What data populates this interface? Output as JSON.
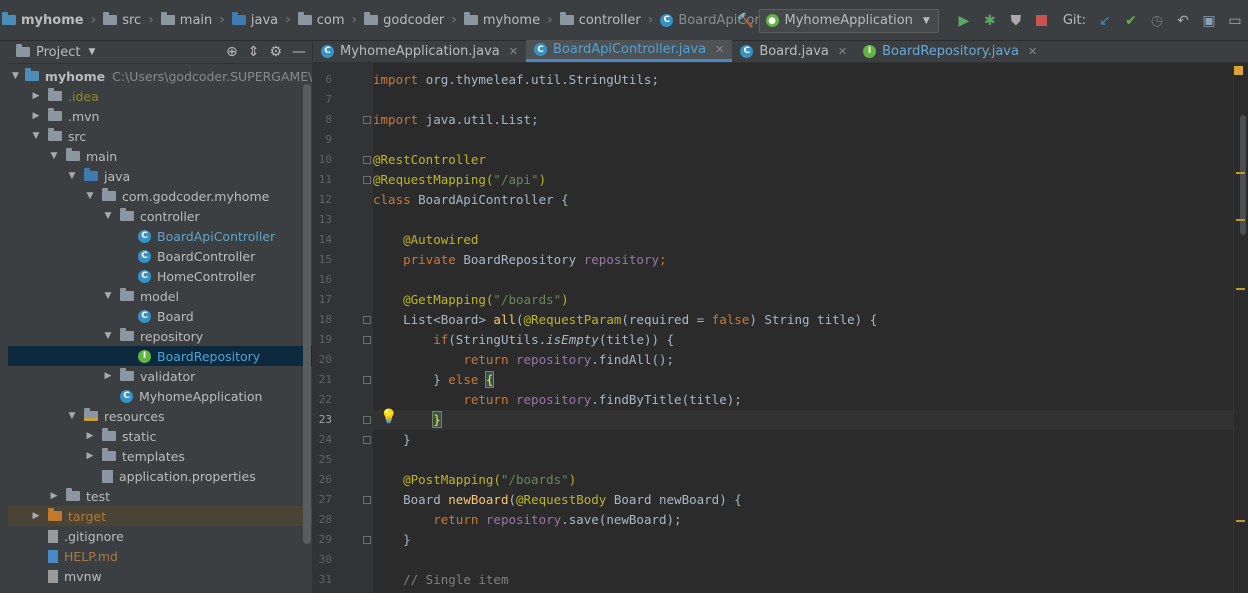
{
  "breadcrumbs": [
    "myhome",
    "src",
    "main",
    "java",
    "com",
    "godcoder",
    "myhome",
    "controller",
    "BoardApiController"
  ],
  "run_config": "MyhomeApplication",
  "git_label": "Git:",
  "project_panel": {
    "title": "Project",
    "tree": [
      {
        "label": "myhome",
        "extra": "C:\\Users\\godcoder.SUPERGAME\\Do",
        "icon": "module-folder-icon",
        "arrow": "down"
      },
      {
        "label": ".idea",
        "icon": "folder-icon",
        "arrow": "right"
      },
      {
        "label": ".mvn",
        "icon": "folder-icon",
        "arrow": "right"
      },
      {
        "label": "src",
        "icon": "folder-icon",
        "arrow": "down"
      },
      {
        "label": "main",
        "icon": "folder-icon",
        "arrow": "down"
      },
      {
        "label": "java",
        "icon": "source-folder-icon",
        "arrow": "down"
      },
      {
        "label": "com.godcoder.myhome",
        "icon": "package-icon",
        "arrow": "down"
      },
      {
        "label": "controller",
        "icon": "package-icon",
        "arrow": "down"
      },
      {
        "label": "BoardApiController",
        "icon": "class-icon",
        "arrow": ""
      },
      {
        "label": "BoardController",
        "icon": "class-icon",
        "arrow": ""
      },
      {
        "label": "HomeController",
        "icon": "class-icon",
        "arrow": ""
      },
      {
        "label": "model",
        "icon": "package-icon",
        "arrow": "down"
      },
      {
        "label": "Board",
        "icon": "class-icon",
        "arrow": ""
      },
      {
        "label": "repository",
        "icon": "package-icon",
        "arrow": "down"
      },
      {
        "label": "BoardRepository",
        "icon": "interface-icon",
        "arrow": ""
      },
      {
        "label": "validator",
        "icon": "package-icon",
        "arrow": "right"
      },
      {
        "label": "MyhomeApplication",
        "icon": "spring-class-icon",
        "arrow": ""
      },
      {
        "label": "resources",
        "icon": "resources-folder-icon",
        "arrow": "down"
      },
      {
        "label": "static",
        "icon": "folder-icon",
        "arrow": "right"
      },
      {
        "label": "templates",
        "icon": "folder-icon",
        "arrow": "right"
      },
      {
        "label": "application.properties",
        "icon": "properties-file-icon",
        "arrow": ""
      },
      {
        "label": "test",
        "icon": "folder-icon",
        "arrow": "right"
      },
      {
        "label": "target",
        "icon": "excluded-folder-icon",
        "arrow": "right"
      },
      {
        "label": ".gitignore",
        "icon": "text-file-icon",
        "arrow": ""
      },
      {
        "label": "HELP.md",
        "icon": "markdown-file-icon",
        "arrow": ""
      },
      {
        "label": "mvnw",
        "icon": "text-file-icon",
        "arrow": ""
      }
    ]
  },
  "editor_tabs": [
    {
      "label": "MyhomeApplication.java",
      "icon": "class-icon"
    },
    {
      "label": "BoardApiController.java",
      "icon": "class-icon",
      "active": true
    },
    {
      "label": "Board.java",
      "icon": "class-icon"
    },
    {
      "label": "BoardRepository.java",
      "icon": "interface-icon"
    }
  ],
  "line_numbers": [
    "6",
    "7",
    "8",
    "9",
    "10",
    "11",
    "12",
    "13",
    "14",
    "15",
    "16",
    "17",
    "18",
    "19",
    "20",
    "21",
    "22",
    "23",
    "24",
    "25",
    "26",
    "27",
    "28",
    "29",
    "30",
    "31"
  ],
  "code": {
    "l6": "import org.thymeleaf.util.StringUtils;",
    "l8": "import java.util.List;",
    "l10_ann": "@RestController",
    "l11_ann": "@RequestMapping(",
    "l11_str": "\"/api\"",
    "l12_kw": "class ",
    "l12_name": "BoardApiController {",
    "l14_ann": "@Autowired",
    "l15_kw": "private ",
    "l15_type": "BoardRepository ",
    "l15_fld": "repository",
    "l17_ann": "@GetMapping(",
    "l17_str": "\"/boards\"",
    "l18_a": "List<Board> ",
    "l18_m": "all",
    "l18_b": "(",
    "l18_ann": "@RequestParam",
    "l18_c": "(required = ",
    "l18_kw": "false",
    "l18_d": ") String title) {",
    "l19_kw": "if",
    "l19_a": "(StringUtils.",
    "l19_m": "isEmpty",
    "l19_b": "(title)) {",
    "l20_kw": "return ",
    "l20_fld": "repository",
    "l20_a": ".findAll();",
    "l21_a": "} ",
    "l21_kw": "else ",
    "l21_b": "{",
    "l22_kw": "return ",
    "l22_fld": "repository",
    "l22_a": ".findByTitle(title);",
    "l23": "}",
    "l24": "}",
    "l26_ann": "@PostMapping(",
    "l26_str": "\"/boards\"",
    "l27_a": "Board ",
    "l27_m": "newBoard",
    "l27_ann": "@RequestBody",
    "l27_b": " Board newBoard) {",
    "l28_kw": "return ",
    "l28_fld": "repository",
    "l28_a": ".save(newBoard);",
    "l29": "}",
    "l31": "// Single item"
  },
  "colors": {
    "keyword": "#cc7832",
    "annotation": "#bbb529",
    "string": "#6a8759",
    "field": "#9876aa",
    "method": "#ffc66d",
    "text": "#a9b7c6"
  }
}
